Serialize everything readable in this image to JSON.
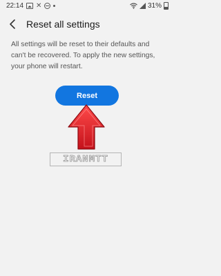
{
  "status_bar": {
    "time": "22:14",
    "battery": "31%",
    "icons": [
      "gallery-icon",
      "x-icon",
      "do-not-disturb-icon",
      "dot-icon",
      "wifi-icon",
      "signal-icon",
      "battery-icon"
    ]
  },
  "header": {
    "back_icon": "chevron-left-icon",
    "title": "Reset all settings"
  },
  "description": "All settings will be reset to their defaults and can't be recovered. To apply the new settings, your phone will restart.",
  "reset_button": {
    "label": "Reset"
  },
  "annotation": {
    "arrow_color": "#e8202a"
  },
  "watermark": {
    "text": "IRANMTT"
  },
  "colors": {
    "accent": "#1276e0",
    "background": "#f2f2f2"
  }
}
